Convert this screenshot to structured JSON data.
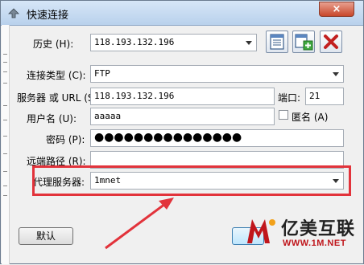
{
  "window": {
    "title": "快速连接",
    "close_glyph": "×"
  },
  "history": {
    "label": "历史 (H):",
    "value": "118.193.132.196"
  },
  "toolbar_icons": [
    "address-book-icon",
    "add-entry-icon",
    "delete-icon"
  ],
  "connection_type": {
    "label": "连接类型 (C):",
    "value": "FTP"
  },
  "server": {
    "label": "服务器 或 URL (S):",
    "value": "118.193.132.196",
    "port_label": "端口:",
    "port_value": "21"
  },
  "username": {
    "label": "用户名 (U):",
    "value": "aaaaa",
    "anonymous_label": "匿名 (A)",
    "anonymous_checked": false
  },
  "password": {
    "label": "密码 (P):",
    "value": "●●●●●●●●●●●●●●●"
  },
  "remote_path": {
    "label": "远端路径 (R):",
    "value": ""
  },
  "proxy": {
    "label": "代理服务器:",
    "value": "1mnet"
  },
  "buttons": {
    "default_label": "默认"
  },
  "annotation": {
    "highlight_color": "#e2333b"
  },
  "watermark": {
    "name": "亿美互联",
    "url": "WWW.1M.NET",
    "brand_color": "#c0161c"
  }
}
